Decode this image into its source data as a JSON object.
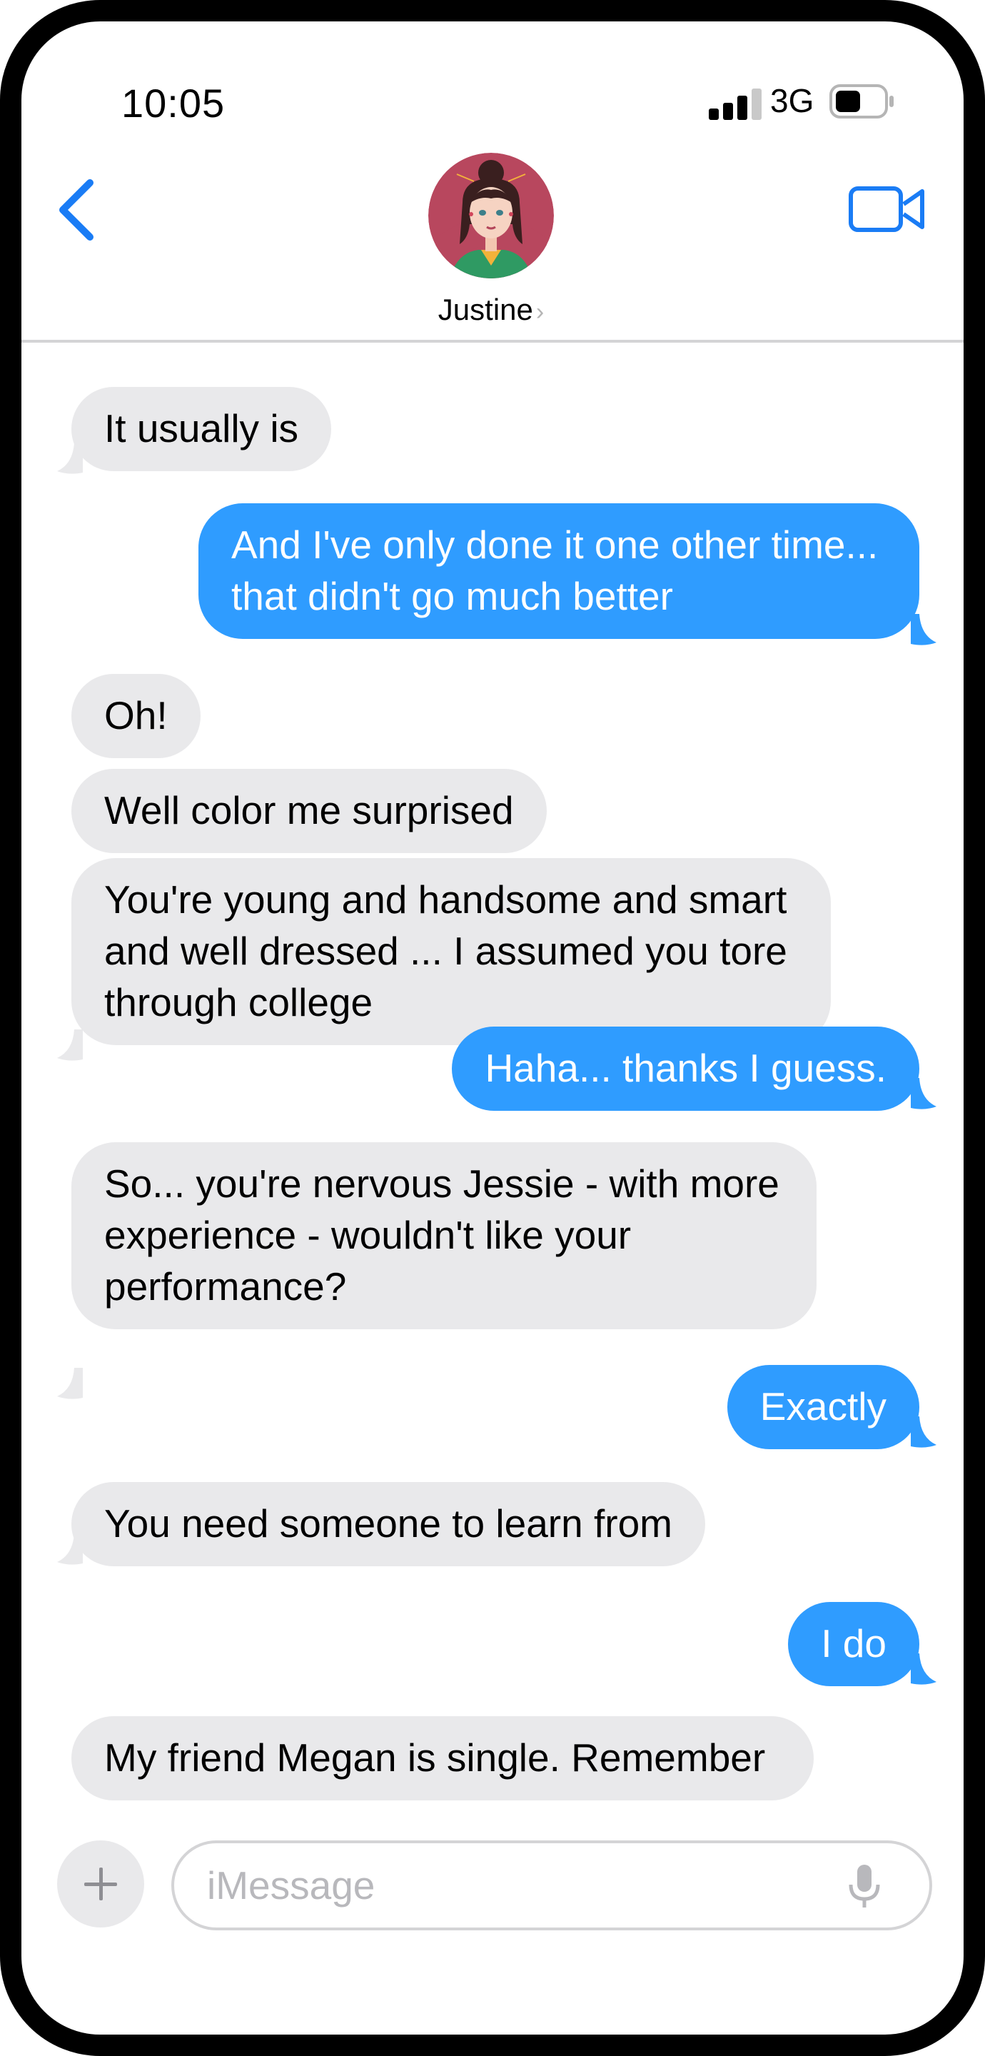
{
  "status_bar": {
    "time": "10:05",
    "network": "3G",
    "signal_icon": "cellular-signal-icon",
    "battery_icon": "battery-icon"
  },
  "header": {
    "contact_name": "Justine",
    "back_icon": "chevron-left-icon",
    "video_icon": "video-camera-icon",
    "accent_color": "#1a7cf5"
  },
  "messages": [
    {
      "direction": "incoming",
      "text": "It usually is"
    },
    {
      "direction": "outgoing",
      "text": "And I've only done it one other time...\nthat didn't go much better"
    },
    {
      "direction": "incoming",
      "text": "Oh!"
    },
    {
      "direction": "incoming",
      "text": "Well color me surprised"
    },
    {
      "direction": "incoming",
      "text": "You're young and handsome and smart\nand well dressed ... I assumed you tore\nthrough college"
    },
    {
      "direction": "outgoing",
      "text": "Haha... thanks I guess."
    },
    {
      "direction": "incoming",
      "text": "So... you're nervous Jessie - with more\nexperience - wouldn't like your\nperformance?"
    },
    {
      "direction": "outgoing",
      "text": "Exactly"
    },
    {
      "direction": "incoming",
      "text": "You need someone to learn from"
    },
    {
      "direction": "outgoing",
      "text": "I do"
    },
    {
      "direction": "incoming",
      "text": "My friend Megan is single.  Remember"
    }
  ],
  "composer": {
    "placeholder": "iMessage",
    "value": "",
    "plus_icon": "plus-icon",
    "mic_icon": "microphone-icon"
  },
  "colors": {
    "incoming_bubble": "#e9e9eb",
    "outgoing_bubble": "#2f9cff"
  }
}
